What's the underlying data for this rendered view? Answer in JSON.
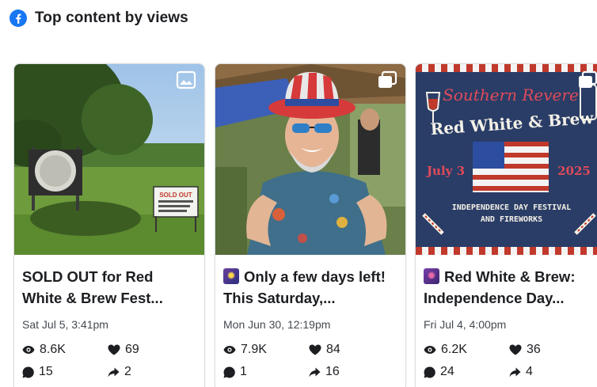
{
  "header": {
    "title": "Top content by views",
    "icon": "facebook-icon",
    "brand_color": "#1877f2"
  },
  "cards": [
    {
      "title": "SOLD OUT for Red White & Brew Fest...",
      "date": "Sat Jul 5, 3:41pm",
      "views": "8.6K",
      "reactions": "69",
      "comments": "15",
      "shares": "2",
      "media_type": "photo-icon",
      "sign_text": "SOLD OUT"
    },
    {
      "title": "Only a few days left! This Saturday,...",
      "date": "Mon Jun 30, 12:19pm",
      "views": "7.9K",
      "reactions": "84",
      "comments": "1",
      "shares": "16",
      "media_type": "album-icon"
    },
    {
      "title": "Red White & Brew: Independence Day...",
      "date": "Fri Jul 4, 4:00pm",
      "views": "6.2K",
      "reactions": "36",
      "comments": "24",
      "shares": "4",
      "media_type": "album-icon",
      "poster": {
        "brand": "Southern Revere",
        "headline": "Red White & Brew",
        "date_left": "July 3",
        "date_right": "2025",
        "subtitle_1": "INDEPENDENCE DAY FESTIVAL",
        "subtitle_2": "AND FIREWORKS"
      }
    }
  ]
}
